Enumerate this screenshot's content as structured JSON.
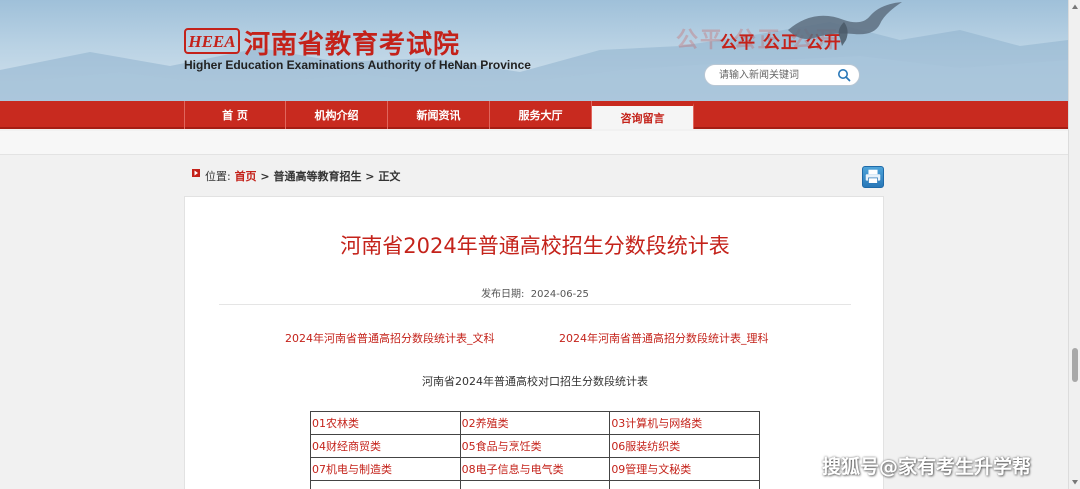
{
  "header": {
    "logo_badge": "HEEA",
    "logo_cn": "河南省教育考试院",
    "logo_en": "Higher Education Examinations Authority of HeNan Province",
    "slogan": "公平 公正 公开",
    "search_placeholder": "请输入新闻关键词",
    "brand_color": "#c4221a"
  },
  "nav": {
    "items": [
      {
        "label": "首 页"
      },
      {
        "label": "机构介绍"
      },
      {
        "label": "新闻资讯"
      },
      {
        "label": "服务大厅"
      },
      {
        "label": "咨询留言"
      }
    ],
    "active_index": 4
  },
  "breadcrumb": {
    "prefix": "位置:",
    "home": "首页",
    "sep1": " > ",
    "section": "普通高等教育招生",
    "sep2": " > ",
    "current": "正文"
  },
  "article": {
    "title": "河南省2024年普通高校招生分数段统计表",
    "date_label": "发布日期:",
    "date_value": "2024-06-25",
    "links": [
      "2024年河南省普通高招分数段统计表_文科",
      "2024年河南省普通高招分数段统计表_理科"
    ],
    "subtitle": "河南省2024年普通高校对口招生分数段统计表",
    "categories": [
      [
        "01农林类",
        "02养殖类",
        "03计算机与网络类"
      ],
      [
        "04财经商贸类",
        "05食品与烹饪类",
        "06服装纺织类"
      ],
      [
        "07机电与制造类",
        "08电子信息与电气类",
        "09管理与文秘类"
      ]
    ]
  },
  "watermark": "搜狐号@家有考生升学帮"
}
